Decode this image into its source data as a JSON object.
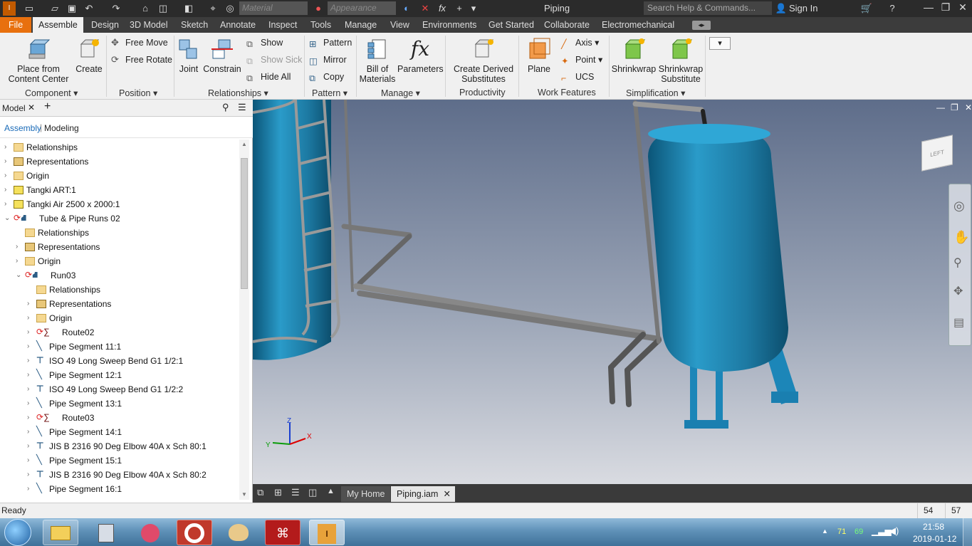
{
  "titlebar": {
    "title": "Piping",
    "material_placeholder": "Material",
    "appearance_placeholder": "Appearance",
    "search_placeholder": "Search Help & Commands...",
    "signin_label": "Sign In"
  },
  "tabs": [
    "File",
    "Assemble",
    "Design",
    "3D Model",
    "Sketch",
    "Annotate",
    "Inspect",
    "Tools",
    "Manage",
    "View",
    "Environments",
    "Get Started",
    "Collaborate",
    "Electromechanical"
  ],
  "active_tab": "Assemble",
  "ribbon": {
    "component": {
      "place_from": "Place from",
      "content_center": "Content Center",
      "create": "Create",
      "panel": "Component"
    },
    "position": {
      "free_move": "Free Move",
      "free_rotate": "Free Rotate",
      "panel": "Position"
    },
    "relationships": {
      "joint": "Joint",
      "constrain": "Constrain",
      "show": "Show",
      "show_sick": "Show Sick",
      "hide_all": "Hide All",
      "panel": "Relationships"
    },
    "pattern": {
      "pattern": "Pattern",
      "mirror": "Mirror",
      "copy": "Copy",
      "panel": "Pattern"
    },
    "manage": {
      "bom_1": "Bill of",
      "bom_2": "Materials",
      "parameters": "Parameters",
      "panel": "Manage"
    },
    "productivity": {
      "derived_1": "Create Derived",
      "derived_2": "Substitutes",
      "panel": "Productivity"
    },
    "work_features": {
      "plane": "Plane",
      "axis": "Axis",
      "point": "Point",
      "ucs": "UCS",
      "panel": "Work Features"
    },
    "simplification": {
      "shrinkwrap": "Shrinkwrap",
      "shrinkwrap2_1": "Shrinkwrap",
      "shrinkwrap2_2": "Substitute",
      "panel": "Simplification"
    }
  },
  "browser": {
    "tab_label": "Model",
    "assembly_label": "Assembly",
    "modeling_label": "Modeling",
    "tree": [
      {
        "label": "Relationships",
        "indent": 0,
        "icon": "folder",
        "expander": "closed"
      },
      {
        "label": "Representations",
        "indent": 0,
        "icon": "representations",
        "expander": "closed"
      },
      {
        "label": "Origin",
        "indent": 0,
        "icon": "folder",
        "expander": "closed"
      },
      {
        "label": "Tangki ART:1",
        "indent": 0,
        "icon": "part",
        "expander": "closed"
      },
      {
        "label": "Tangki Air 2500 x 2000:1",
        "indent": 0,
        "icon": "part",
        "expander": "closed"
      },
      {
        "label": "Tube & Pipe Runs 02",
        "indent": 0,
        "icon": "runs",
        "expander": "open"
      },
      {
        "label": "Relationships",
        "indent": 1,
        "icon": "folder",
        "expander": "none"
      },
      {
        "label": "Representations",
        "indent": 1,
        "icon": "representations",
        "expander": "closed"
      },
      {
        "label": "Origin",
        "indent": 1,
        "icon": "folder",
        "expander": "closed"
      },
      {
        "label": "Run03",
        "indent": 1,
        "icon": "runs",
        "expander": "open"
      },
      {
        "label": "Relationships",
        "indent": 2,
        "icon": "folder",
        "expander": "none"
      },
      {
        "label": "Representations",
        "indent": 2,
        "icon": "representations",
        "expander": "closed"
      },
      {
        "label": "Origin",
        "indent": 2,
        "icon": "folder",
        "expander": "closed"
      },
      {
        "label": "Route02",
        "indent": 2,
        "icon": "route",
        "expander": "closed"
      },
      {
        "label": "Pipe Segment 11:1",
        "indent": 2,
        "icon": "pipe",
        "expander": "closed"
      },
      {
        "label": "ISO 49 Long Sweep Bend G1 1/2:1",
        "indent": 2,
        "icon": "fitting",
        "expander": "closed"
      },
      {
        "label": "Pipe Segment 12:1",
        "indent": 2,
        "icon": "pipe",
        "expander": "closed"
      },
      {
        "label": "ISO 49 Long Sweep Bend G1 1/2:2",
        "indent": 2,
        "icon": "fitting",
        "expander": "closed"
      },
      {
        "label": "Pipe Segment 13:1",
        "indent": 2,
        "icon": "pipe",
        "expander": "closed"
      },
      {
        "label": "Route03",
        "indent": 2,
        "icon": "route",
        "expander": "closed"
      },
      {
        "label": "Pipe Segment 14:1",
        "indent": 2,
        "icon": "pipe",
        "expander": "closed"
      },
      {
        "label": "JIS B 2316 90 Deg Elbow 40A x Sch 80:1",
        "indent": 2,
        "icon": "fitting",
        "expander": "closed"
      },
      {
        "label": "Pipe Segment 15:1",
        "indent": 2,
        "icon": "pipe",
        "expander": "closed"
      },
      {
        "label": "JIS B 2316 90 Deg Elbow 40A x Sch 80:2",
        "indent": 2,
        "icon": "fitting",
        "expander": "closed"
      },
      {
        "label": "Pipe Segment 16:1",
        "indent": 2,
        "icon": "pipe",
        "expander": "closed"
      }
    ]
  },
  "viewcube": {
    "face_label": "LEFT"
  },
  "triad": {
    "x": "X",
    "y": "Y",
    "z": "Z"
  },
  "doc_tabs": {
    "home": "My Home",
    "active": "Piping.iam"
  },
  "status": {
    "text": "Ready",
    "num1": "54",
    "num2": "57"
  },
  "taskbar": {
    "time": "21:58",
    "date": "2019-01-12",
    "tray_a": "71",
    "tray_b": "69"
  },
  "colors": {
    "accent_file": "#e8700e",
    "tank": "#1e7fa8",
    "title_bg": "#2b2b2b"
  }
}
